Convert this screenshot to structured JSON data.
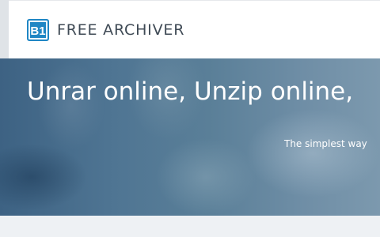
{
  "brand": {
    "logo_icon": "b1-archive-logo-icon",
    "name": "FREE ARCHIVER",
    "accent_color": "#1f86c4"
  },
  "hero": {
    "title": "Unrar online, Unzip online,",
    "subtitle": "The simplest way"
  }
}
